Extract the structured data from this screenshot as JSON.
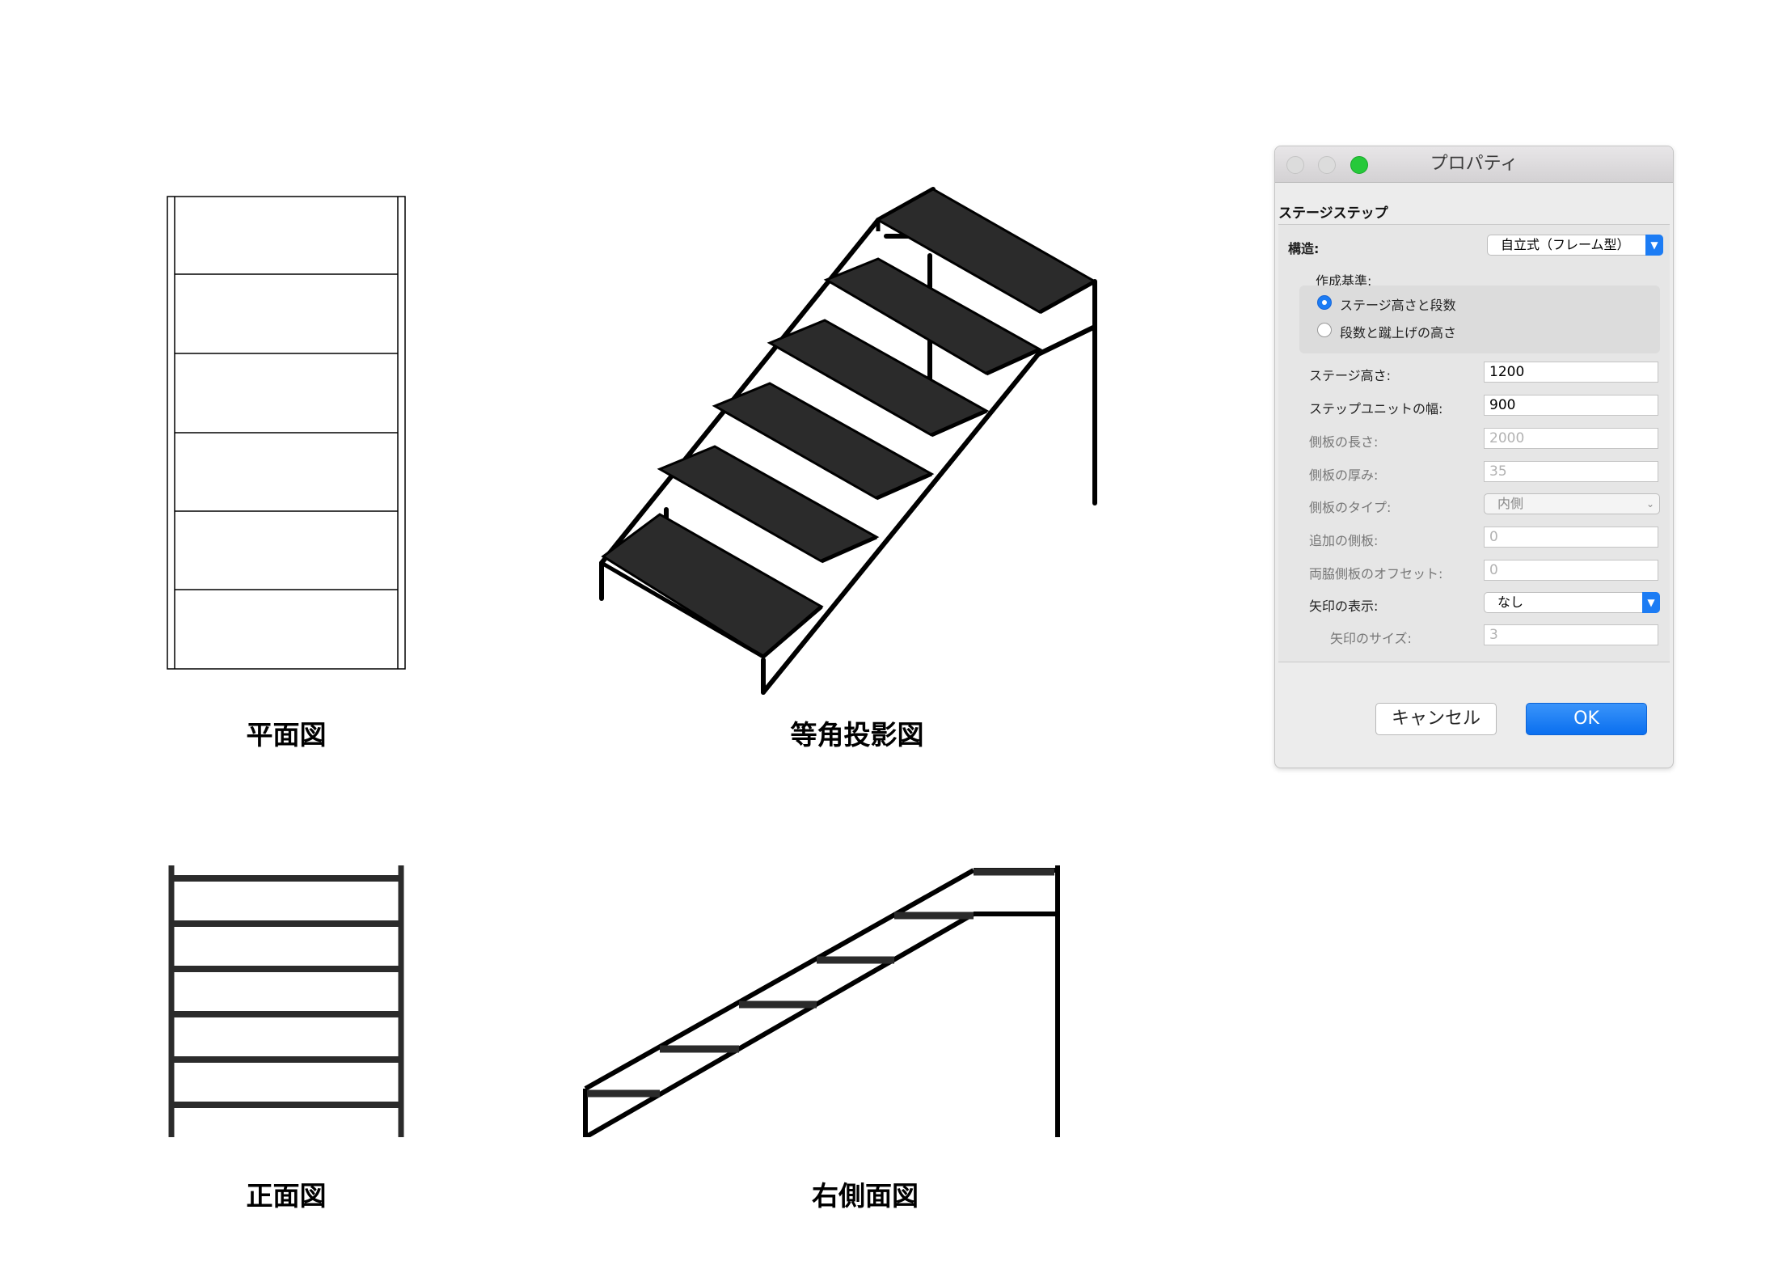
{
  "captions": {
    "plan": "平面図",
    "isometric": "等角投影図",
    "front": "正面図",
    "right_side": "右側面図"
  },
  "dialog": {
    "title": "プロパティ",
    "section": "ステージステップ",
    "structure_label": "構造:",
    "structure_value": "自立式（フレーム型）",
    "creation_basis_label": "作成基準:",
    "radio_options": [
      {
        "label": "ステージ高さと段数",
        "selected": true
      },
      {
        "label": "段数と蹴上げの高さ",
        "selected": false
      }
    ],
    "fields": [
      {
        "label": "ステージ高さ:",
        "value": "1200",
        "enabled": true
      },
      {
        "label": "ステップユニットの幅:",
        "value": "900",
        "enabled": true
      },
      {
        "label": "側板の長さ:",
        "value": "2000",
        "enabled": false
      },
      {
        "label": "側板の厚み:",
        "value": "35",
        "enabled": false
      }
    ],
    "side_type_label": "側板のタイプ:",
    "side_type_value": "内側",
    "fields2": [
      {
        "label": "追加の側板:",
        "value": "0",
        "enabled": false
      },
      {
        "label": "両脇側板のオフセット:",
        "value": "0",
        "enabled": false
      }
    ],
    "arrow_display_label": "矢印の表示:",
    "arrow_display_value": "なし",
    "arrow_size_label": "矢印のサイズ:",
    "arrow_size_value": "3",
    "cancel_label": "キャンセル",
    "ok_label": "OK"
  },
  "colors": {
    "accent": "#1c7cf4",
    "stair_fill": "#2b2b2b",
    "stroke": "#000000"
  }
}
